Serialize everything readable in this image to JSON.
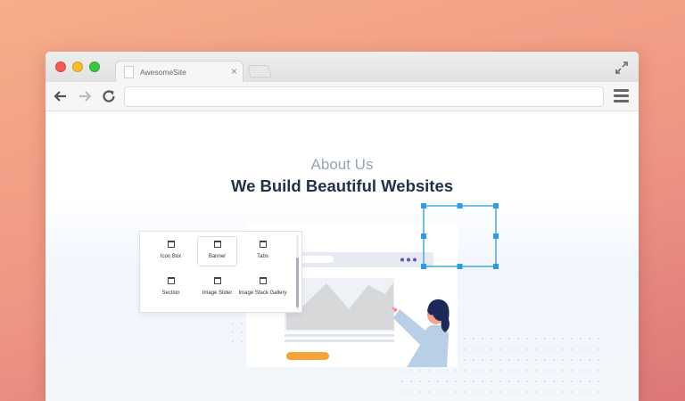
{
  "browser": {
    "tab_title": "AwesomeSite",
    "tab_close": "×",
    "url": ""
  },
  "hero": {
    "eyebrow": "About Us",
    "title": "We Build Beautiful Websites"
  },
  "widgets": [
    {
      "label": "Icon Box",
      "icon": "icon-box-icon"
    },
    {
      "label": "Banner",
      "icon": "banner-icon",
      "selected": true
    },
    {
      "label": "Tabs",
      "icon": "tabs-icon"
    },
    {
      "label": "Section",
      "icon": "section-icon"
    },
    {
      "label": "Image Slider",
      "icon": "image-slider-icon"
    },
    {
      "label": "Image Stack Gallery",
      "icon": "image-stack-gallery-icon"
    }
  ],
  "colors": {
    "accent_selection": "#2f9be0",
    "button_orange": "#f5a33a",
    "dots_purple": "#6c4fb0",
    "heading": "#23314b"
  }
}
